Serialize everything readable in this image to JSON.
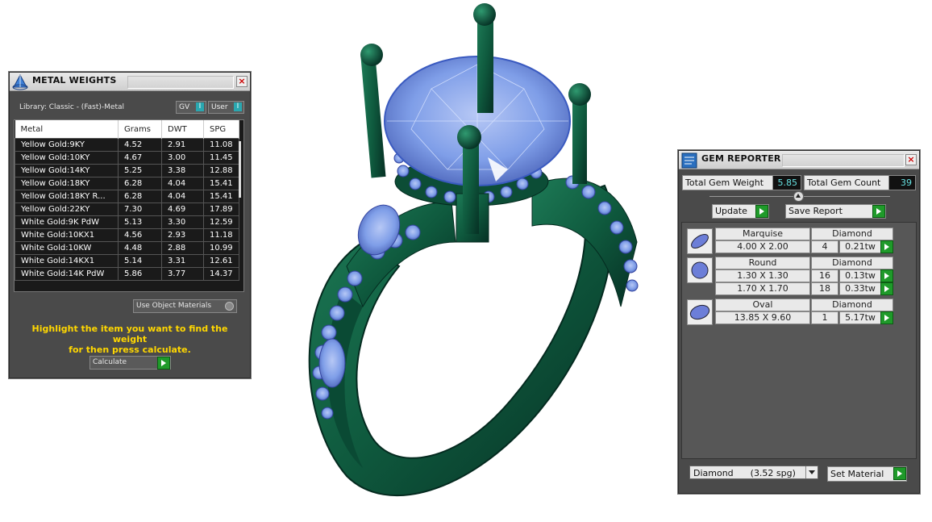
{
  "metal_panel": {
    "title": "METAL WEIGHTS",
    "library": "Library: Classic - (Fast)-Metal",
    "toggle_gv": "GV",
    "toggle_user": "User",
    "columns": [
      "Metal",
      "Grams",
      "DWT",
      "SPG"
    ],
    "rows": [
      [
        "Yellow Gold:9KY",
        "4.52",
        "2.91",
        "11.08"
      ],
      [
        "Yellow Gold:10KY",
        "4.67",
        "3.00",
        "11.45"
      ],
      [
        "Yellow Gold:14KY",
        "5.25",
        "3.38",
        "12.88"
      ],
      [
        "Yellow Gold:18KY",
        "6.28",
        "4.04",
        "15.41"
      ],
      [
        "Yellow Gold:18KY R...",
        "6.28",
        "4.04",
        "15.41"
      ],
      [
        "Yellow Gold:22KY",
        "7.30",
        "4.69",
        "17.89"
      ],
      [
        "White Gold:9K PdW",
        "5.13",
        "3.30",
        "12.59"
      ],
      [
        "White Gold:10KX1",
        "4.56",
        "2.93",
        "11.18"
      ],
      [
        "White Gold:10KW",
        "4.48",
        "2.88",
        "10.99"
      ],
      [
        "White Gold:14KX1",
        "5.14",
        "3.31",
        "12.61"
      ],
      [
        "White Gold:14K PdW",
        "5.86",
        "3.77",
        "14.37"
      ]
    ],
    "use_object_materials": "Use Object Materials",
    "hint_line1": "Highlight the item you want to find the weight",
    "hint_line2": "for then press calculate.",
    "calculate": "Calculate"
  },
  "gem_panel": {
    "title": "GEM REPORTER",
    "total_weight_label": "Total Gem Weight",
    "total_weight_value": "5.85",
    "total_count_label": "Total Gem Count",
    "total_count_value": "39",
    "update": "Update",
    "save_report": "Save Report",
    "gems": [
      {
        "shape": "Marquise",
        "material": "Diamond",
        "sizes": [
          {
            "size": "4.00 X 2.00",
            "count": "4",
            "weight": "0.21tw"
          }
        ]
      },
      {
        "shape": "Round",
        "material": "Diamond",
        "sizes": [
          {
            "size": "1.30 X 1.30",
            "count": "16",
            "weight": "0.13tw"
          },
          {
            "size": "1.70 X 1.70",
            "count": "18",
            "weight": "0.33tw"
          }
        ]
      },
      {
        "shape": "Oval",
        "material": "Diamond",
        "sizes": [
          {
            "size": "13.85 X 9.60",
            "count": "1",
            "weight": "5.17tw"
          }
        ]
      }
    ],
    "material_select": "Diamond      (3.52 spg)",
    "set_material": "Set Material"
  },
  "colors": {
    "metal_green": "#0f5a3e",
    "gem_blue": "#7f9ee8",
    "hint_yellow": "#ffd700"
  }
}
